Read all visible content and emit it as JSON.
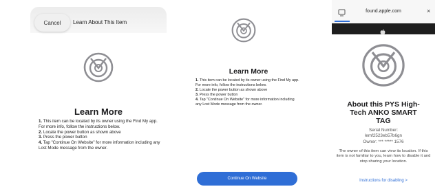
{
  "panel1": {
    "cancel_label": "Cancel",
    "title": "Learn About This Item",
    "heading": "Learn More",
    "steps": [
      {
        "num": "1.",
        "text": " This item can be located by its owner using the Find My app. For more info, follow the instructions below."
      },
      {
        "num": "2.",
        "text": " Locate the power button as shown above"
      },
      {
        "num": "3.",
        "text": " Press the power button"
      },
      {
        "num": "4.",
        "text": " Tap \"Continue On Website\" for more information including any Lost Mode message from the owner."
      }
    ]
  },
  "panel2": {
    "heading": "Learn More",
    "steps": [
      {
        "num": "1.",
        "text": " This item can be located by its owner using the Find My app. For more info, follow the instructions below."
      },
      {
        "num": "2.",
        "text": " Locate the power button as shown above"
      },
      {
        "num": "3.",
        "text": " Press the power button"
      },
      {
        "num": "4.",
        "text": " Tap \"Continue On Website\" for more information including any Lost Mode message from the owner."
      }
    ],
    "button_label": "Continue On Website"
  },
  "panel3": {
    "url": "found.apple.com",
    "close_label": "×",
    "heading_line1": "About this PYS High-",
    "heading_line2": "Tech ANKO SMART",
    "heading_line3": "TAG",
    "serial_label": "Serial Number:",
    "serial_value": "lemf2523eb57b6gn",
    "owner": "Owner: *** ***** 1576",
    "description": "The owner of this item can view its location. If this item is not familiar to you, learn how to disable it and stop sharing your location.",
    "link": "Instructions for disabling  >"
  },
  "colors": {
    "accent": "#2f6ed6",
    "icon_gray": "#8e8e93",
    "dark_bar": "#1e1e1e"
  },
  "icons": [
    "findmy-radar-icon",
    "tab-icon",
    "close-icon",
    "apple-logo-icon"
  ]
}
